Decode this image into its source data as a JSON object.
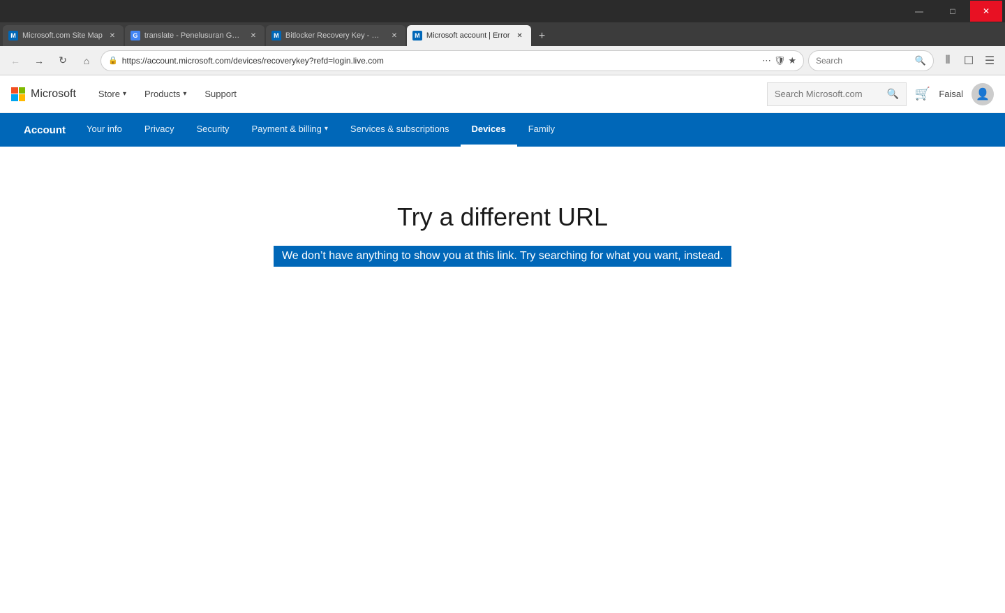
{
  "browser": {
    "tabs": [
      {
        "id": "tab1",
        "label": "Microsoft.com Site Map",
        "favicon_color": "#0067b8",
        "favicon_letter": "M",
        "active": false
      },
      {
        "id": "tab2",
        "label": "translate - Penelusuran Google",
        "favicon_color": "#4285f4",
        "favicon_letter": "G",
        "active": false
      },
      {
        "id": "tab3",
        "label": "Bitlocker Recovery Key - Micro...",
        "favicon_color": "#0067b8",
        "favicon_letter": "M",
        "active": false
      },
      {
        "id": "tab4",
        "label": "Microsoft account | Error",
        "favicon_color": "#0067b8",
        "favicon_letter": "M",
        "active": true
      }
    ],
    "address": "https://account.microsoft.com/devices/recoverykey?refd=login.live.com",
    "new_tab_label": "+",
    "nav_buttons": {
      "back": "←",
      "forward": "→",
      "refresh": "↻",
      "home": "⌂"
    },
    "search_placeholder": "Search"
  },
  "ms_header": {
    "logo_text": "Microsoft",
    "nav_items": [
      {
        "label": "Store",
        "has_dropdown": true
      },
      {
        "label": "Products",
        "has_dropdown": true
      },
      {
        "label": "Support",
        "has_dropdown": false
      }
    ],
    "search_placeholder": "Search Microsoft.com",
    "user_name": "Faisal"
  },
  "account_nav": {
    "label": "Account",
    "items": [
      {
        "label": "Your info",
        "active": false
      },
      {
        "label": "Privacy",
        "active": false
      },
      {
        "label": "Security",
        "active": false
      },
      {
        "label": "Payment & billing",
        "has_dropdown": true,
        "active": false
      },
      {
        "label": "Services & subscriptions",
        "active": false
      },
      {
        "label": "Devices",
        "active": true
      },
      {
        "label": "Family",
        "active": false
      }
    ]
  },
  "main_content": {
    "error_title": "Try a different URL",
    "error_subtitle": "We don’t have anything to show you at this link. Try searching for what you want, instead."
  },
  "colors": {
    "ms_blue": "#0067b8",
    "accent": "#0067b8",
    "highlight_bg": "#0067b8",
    "highlight_text": "#ffffff"
  }
}
